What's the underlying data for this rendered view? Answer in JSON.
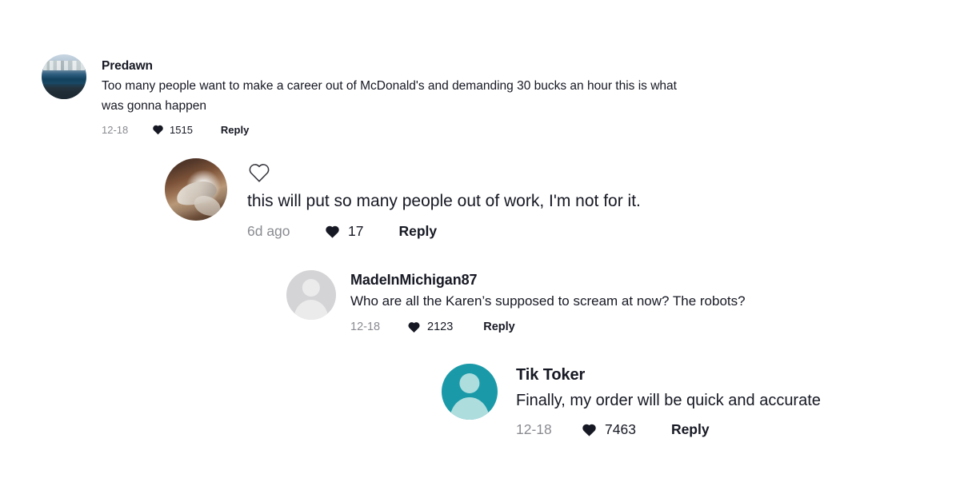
{
  "page": {
    "background_color": "#ffffff",
    "text_color": "#161823",
    "muted_color": "#8a8b91"
  },
  "comments": [
    {
      "id": "predawn",
      "username": "Predawn",
      "show_username": true,
      "avatar": {
        "type": "photo",
        "description": "cityscape-harbor-photo"
      },
      "text": "Too many people want to make a career out of McDonald's and demanding 30 bucks an hour this is what was gonna happen",
      "date": "12-18",
      "like_icon": "heart-filled-icon",
      "likes": "1515",
      "reply_label": "Reply",
      "has_outline_heart": false
    },
    {
      "id": "unnamed-reply",
      "username": "",
      "show_username": false,
      "avatar": {
        "type": "photo",
        "description": "sepia-closeup-photo"
      },
      "text": "this will put so many people out of work, I'm not for it.",
      "date": "6d ago",
      "like_icon": "heart-filled-icon",
      "likes": "17",
      "reply_label": "Reply",
      "has_outline_heart": true,
      "outline_heart_icon": "heart-outline-icon"
    },
    {
      "id": "madeinmichigan87",
      "username": "MadeInMichigan87",
      "show_username": true,
      "avatar": {
        "type": "default-person",
        "background_color": "#d4d4d6",
        "figure_color": "#ebebec"
      },
      "text": "Who are all the Karen’s supposed to scream at now? The robots?",
      "date": "12-18",
      "like_icon": "heart-filled-icon",
      "likes": "2123",
      "reply_label": "Reply",
      "has_outline_heart": false
    },
    {
      "id": "tik-toker",
      "username": "Tik Toker",
      "show_username": true,
      "avatar": {
        "type": "default-person",
        "background_color": "#1a9aa8",
        "figure_color": "#aeddde"
      },
      "text": "Finally, my order will be quick and accurate",
      "date": "12-18",
      "like_icon": "heart-filled-icon",
      "likes": "7463",
      "reply_label": "Reply",
      "has_outline_heart": false
    }
  ]
}
